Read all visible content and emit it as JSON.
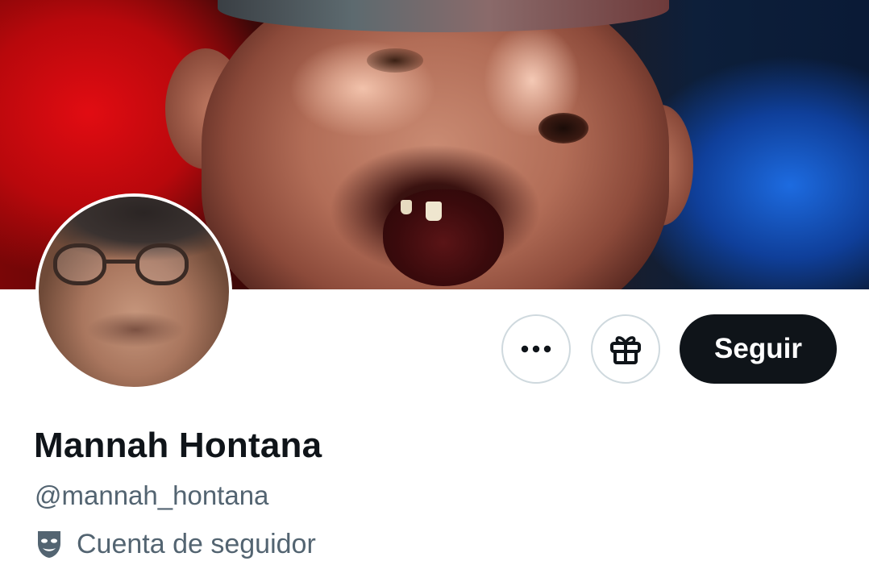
{
  "profile": {
    "display_name": "Mannah Hontana",
    "handle": "@mannah_hontana",
    "account_label": "Cuenta de seguidor"
  },
  "actions": {
    "more_icon": "more-horizontal-icon",
    "gift_icon": "gift-icon",
    "follow_label": "Seguir"
  },
  "icons": {
    "account_label_icon": "theater-mask-icon"
  },
  "colors": {
    "follow_button_bg": "#0f1419",
    "follow_button_text": "#ffffff",
    "primary_text": "#0f1419",
    "secondary_text": "#536471",
    "button_border": "#cfd9de"
  }
}
